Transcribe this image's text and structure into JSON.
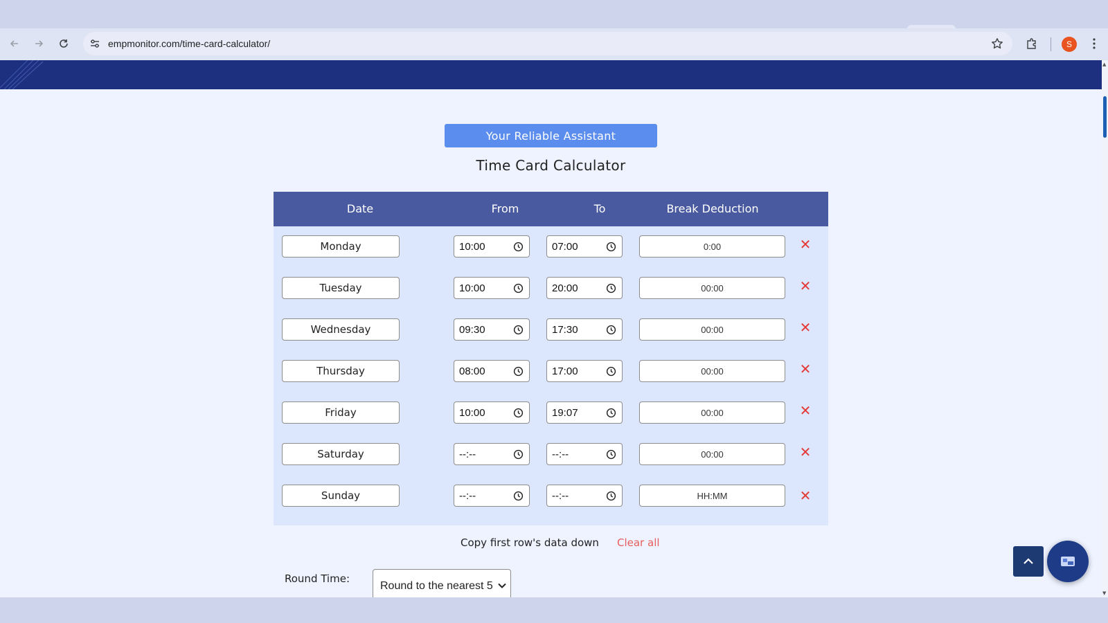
{
  "browser": {
    "url": "empmonitor.com/time-card-calculator/",
    "profile_initial": "S"
  },
  "page": {
    "badge": "Your Reliable Assistant",
    "title": "Time Card Calculator",
    "columns": {
      "date": "Date",
      "from": "From",
      "to": "To",
      "break": "Break Deduction"
    },
    "rows": [
      {
        "day": "Monday",
        "from": "10:00",
        "to": "07:00",
        "break": "0:00"
      },
      {
        "day": "Tuesday",
        "from": "10:00",
        "to": "20:00",
        "break": "00:00"
      },
      {
        "day": "Wednesday",
        "from": "09:30",
        "to": "17:30",
        "break": "00:00"
      },
      {
        "day": "Thursday",
        "from": "08:00",
        "to": "17:00",
        "break": "00:00"
      },
      {
        "day": "Friday",
        "from": "10:00",
        "to": "19:07",
        "break": "00:00"
      },
      {
        "day": "Saturday",
        "from": "--:--",
        "to": "--:--",
        "break": "00:00"
      },
      {
        "day": "Sunday",
        "from": "--:--",
        "to": "--:--",
        "break": "HH:MM"
      }
    ],
    "remove_glyph": "✕",
    "copy_link": "Copy first row's data down",
    "clear_link": "Clear all",
    "round_label": "Round Time:",
    "round_select": "Round to the nearest 5"
  },
  "colors": {
    "header_bg": "#4a5aa0",
    "badge_bg": "#5b8def",
    "hero_bg": "#1d3080",
    "remove": "#e53935",
    "clear_link": "#e85d5d"
  }
}
